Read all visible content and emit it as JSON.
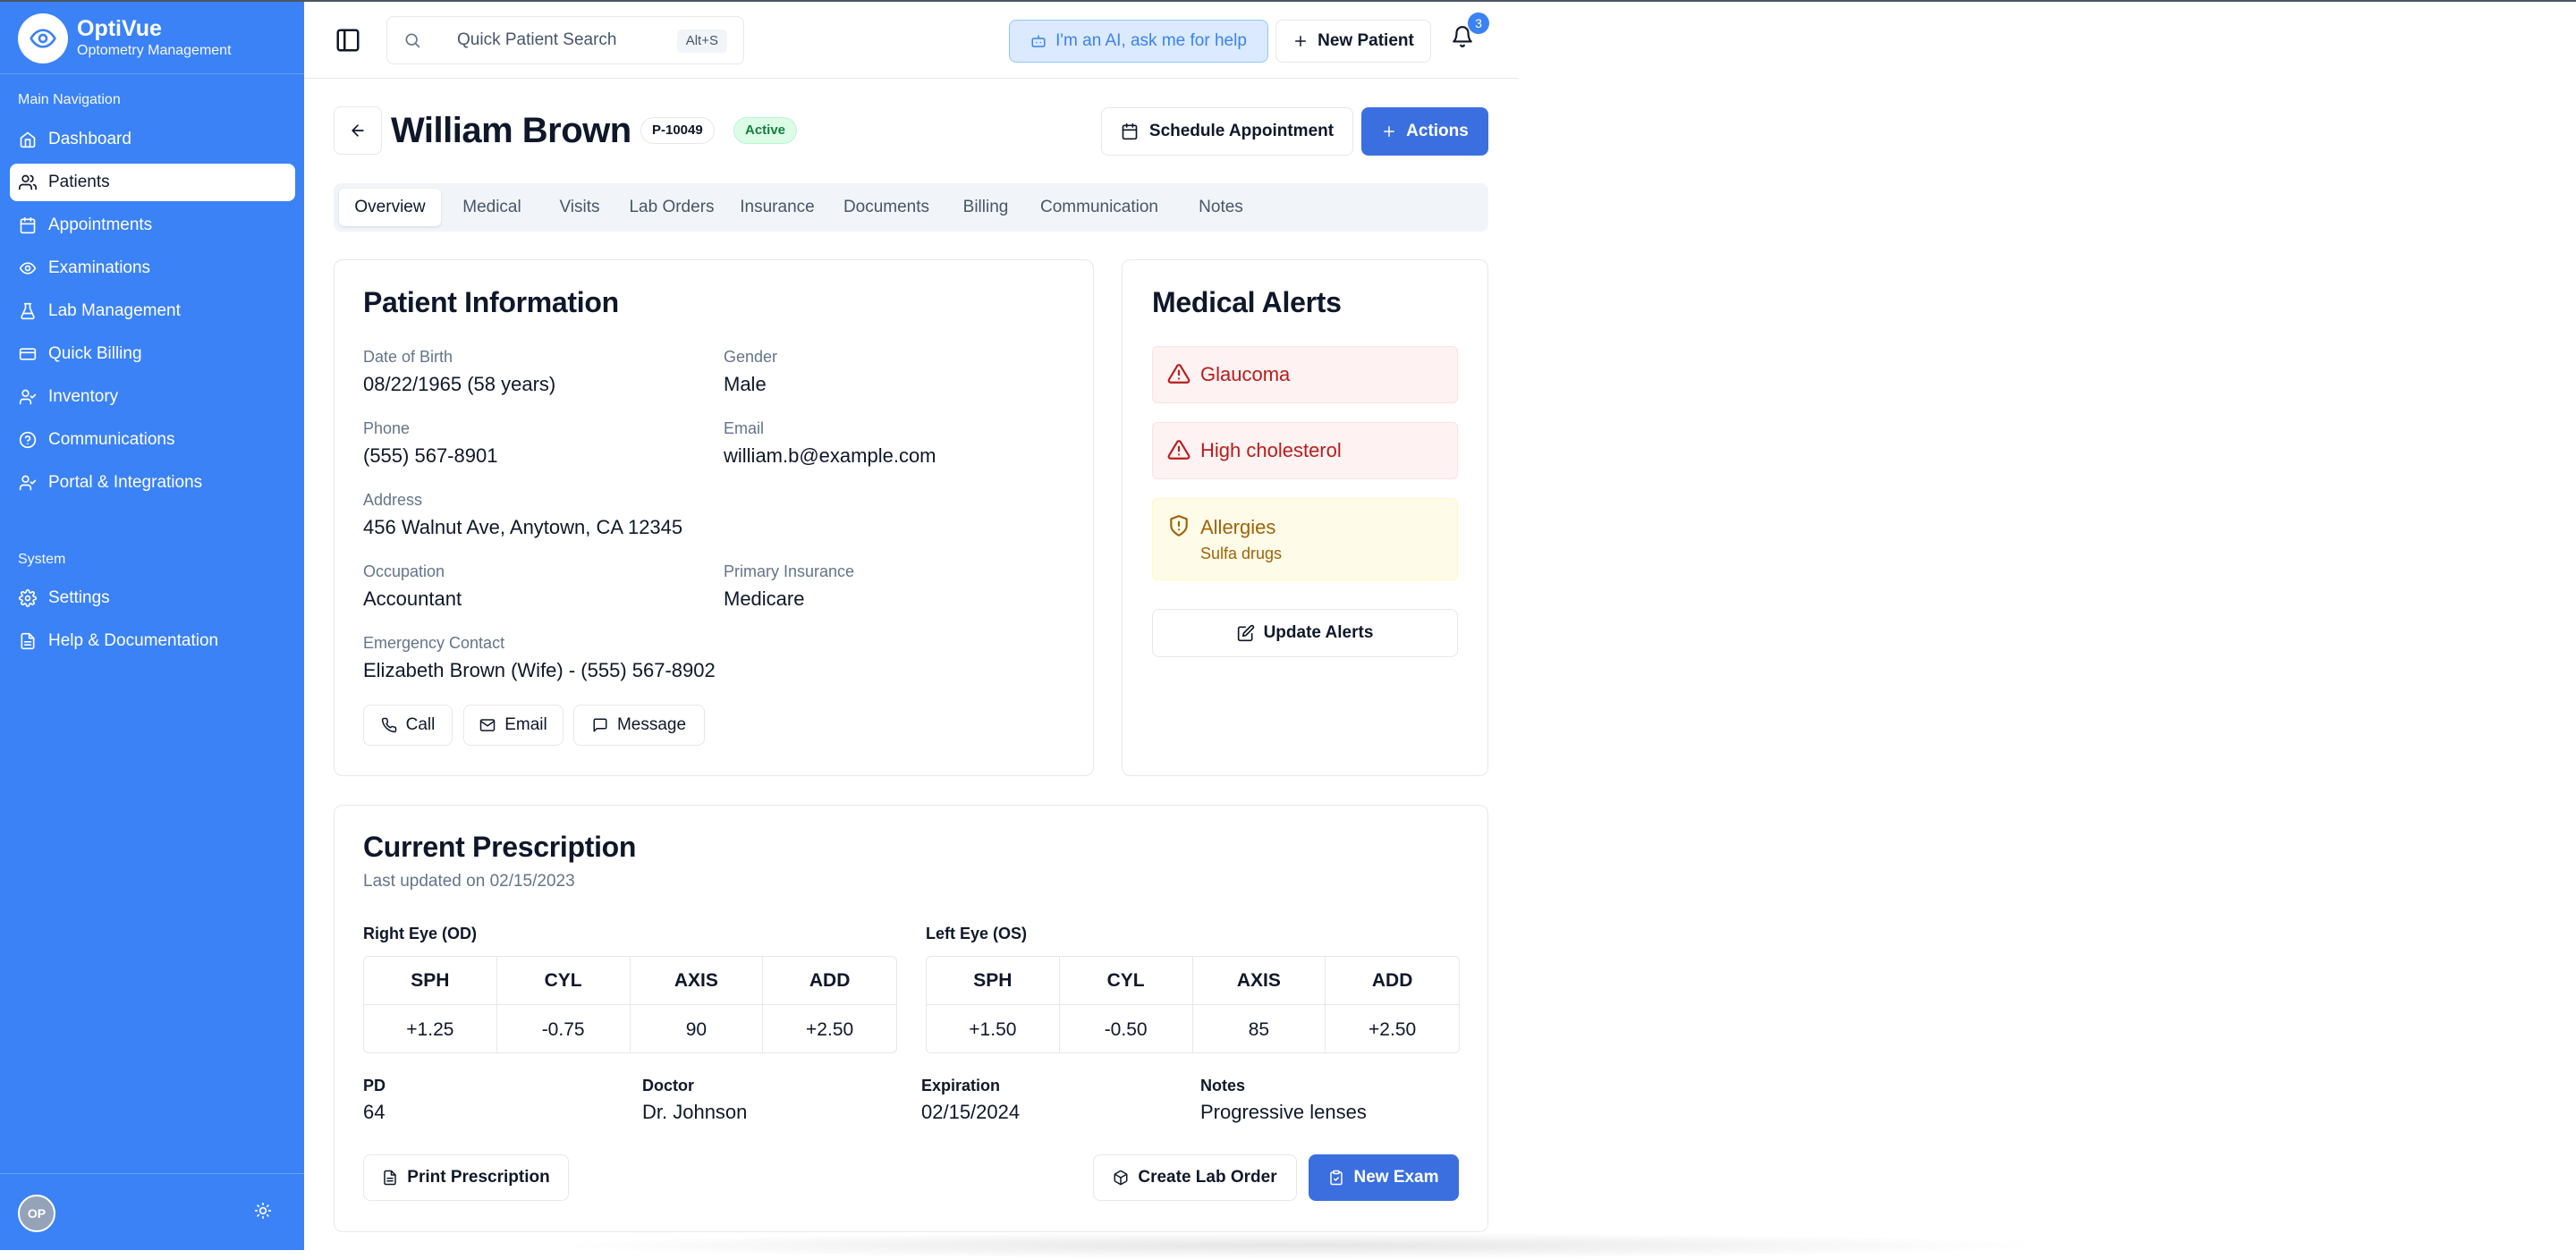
{
  "app": {
    "name": "OptiVue",
    "subtitle": "Optometry Management",
    "user_initials": "OP"
  },
  "sidebar": {
    "main_label": "Main Navigation",
    "items": [
      {
        "label": "Dashboard",
        "icon": "home-icon"
      },
      {
        "label": "Patients",
        "icon": "users-icon",
        "active": true
      },
      {
        "label": "Appointments",
        "icon": "calendar-icon"
      },
      {
        "label": "Examinations",
        "icon": "eye-icon"
      },
      {
        "label": "Lab Management",
        "icon": "flask-icon"
      },
      {
        "label": "Quick Billing",
        "icon": "credit-card-icon"
      },
      {
        "label": "Inventory",
        "icon": "user-check-icon"
      },
      {
        "label": "Communications",
        "icon": "help-circle-icon"
      },
      {
        "label": "Portal & Integrations",
        "icon": "user-check-icon"
      }
    ],
    "system_label": "System",
    "system_items": [
      {
        "label": "Settings",
        "icon": "gear-icon"
      },
      {
        "label": "Help & Documentation",
        "icon": "file-text-icon"
      }
    ]
  },
  "topbar": {
    "search_placeholder": "Quick Patient Search",
    "search_shortcut": "Alt+S",
    "ai_label": "I'm an AI, ask me for help",
    "new_patient_label": "New Patient",
    "notification_count": "3"
  },
  "patient": {
    "name": "William Brown",
    "id": "P-10049",
    "status": "Active",
    "schedule_label": "Schedule Appointment",
    "actions_label": "Actions"
  },
  "tabs": [
    "Overview",
    "Medical",
    "Visits",
    "Lab Orders",
    "Insurance",
    "Documents",
    "Billing",
    "Communication",
    "Notes"
  ],
  "info": {
    "title": "Patient Information",
    "dob_label": "Date of Birth",
    "dob": "08/22/1965 (58 years)",
    "gender_label": "Gender",
    "gender": "Male",
    "phone_label": "Phone",
    "phone": "(555) 567-8901",
    "email_label": "Email",
    "email": "william.b@example.com",
    "address_label": "Address",
    "address": "456 Walnut Ave, Anytown, CA 12345",
    "occupation_label": "Occupation",
    "occupation": "Accountant",
    "insurance_label": "Primary Insurance",
    "insurance": "Medicare",
    "emergency_label": "Emergency Contact",
    "emergency": "Elizabeth Brown (Wife) - (555) 567-8902",
    "call_label": "Call",
    "email_btn_label": "Email",
    "message_label": "Message"
  },
  "alerts": {
    "title": "Medical Alerts",
    "items": [
      {
        "title": "Glaucoma",
        "kind": "danger"
      },
      {
        "title": "High cholesterol",
        "kind": "danger"
      },
      {
        "title": "Allergies",
        "detail": "Sulfa drugs",
        "kind": "warning"
      }
    ],
    "update_label": "Update Alerts",
    "colors": {
      "danger_bg": "#fef2f2",
      "danger_text": "#b91c1c",
      "warning_bg": "#fefce8",
      "warning_text": "#a16207"
    }
  },
  "prescription": {
    "title": "Current Prescription",
    "updated": "Last updated on 02/15/2023",
    "right_label": "Right Eye (OD)",
    "left_label": "Left Eye (OS)",
    "columns": [
      "SPH",
      "CYL",
      "AXIS",
      "ADD"
    ],
    "right_values": [
      "+1.25",
      "-0.75",
      "90",
      "+2.50"
    ],
    "left_values": [
      "+1.50",
      "-0.50",
      "85",
      "+2.50"
    ],
    "pd_label": "PD",
    "pd": "64",
    "doctor_label": "Doctor",
    "doctor": "Dr. Johnson",
    "expiration_label": "Expiration",
    "expiration": "02/15/2024",
    "notes_label": "Notes",
    "notes": "Progressive lenses",
    "print_label": "Print Prescription",
    "lab_order_label": "Create Lab Order",
    "new_exam_label": "New Exam"
  },
  "colors": {
    "sidebar": "#3b82f6",
    "primary": "#3b6fe0"
  }
}
